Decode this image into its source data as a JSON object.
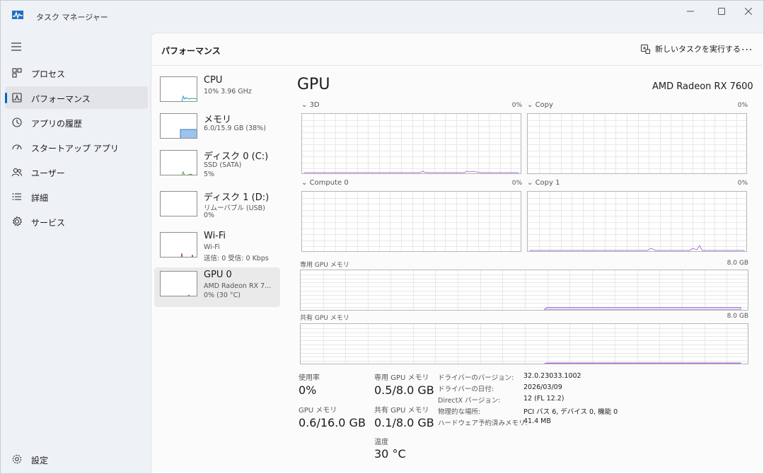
{
  "app": {
    "title": "タスク マネージャー"
  },
  "nav": {
    "items": [
      {
        "label": "プロセス",
        "icon": "processes-icon"
      },
      {
        "label": "パフォーマンス",
        "icon": "performance-icon"
      },
      {
        "label": "アプリの履歴",
        "icon": "history-icon"
      },
      {
        "label": "スタートアップ アプリ",
        "icon": "startup-icon"
      },
      {
        "label": "ユーザー",
        "icon": "users-icon"
      },
      {
        "label": "詳細",
        "icon": "details-icon"
      },
      {
        "label": "サービス",
        "icon": "services-icon"
      }
    ],
    "settings_label": "設定"
  },
  "header": {
    "title": "パフォーマンス",
    "run_task_label": "新しいタスクを実行する",
    "more_label": "..."
  },
  "devices": [
    {
      "name": "CPU",
      "sub1": "10%  3.96 GHz",
      "sub2": ""
    },
    {
      "name": "メモリ",
      "sub1": "6.0/15.9 GB (38%)",
      "sub2": ""
    },
    {
      "name": "ディスク 0 (C:)",
      "sub1": "SSD (SATA)",
      "sub2": "5%"
    },
    {
      "name": "ディスク 1 (D:)",
      "sub1": "リムーバブル (USB)",
      "sub2": "0%"
    },
    {
      "name": "Wi-Fi",
      "sub1": "Wi-Fi",
      "sub2": "送信: 0 受信: 0 Kbps"
    },
    {
      "name": "GPU 0",
      "sub1": "AMD Radeon RX 7...",
      "sub2": "0% (30 °C)"
    }
  ],
  "detail": {
    "title": "GPU",
    "model": "AMD Radeon RX 7600",
    "graphs": {
      "g3d": {
        "label": "3D",
        "pct": "0%"
      },
      "copy": {
        "label": "Copy",
        "pct": "0%"
      },
      "compute0": {
        "label": "Compute 0",
        "pct": "0%"
      },
      "copy1": {
        "label": "Copy 1",
        "pct": "0%"
      },
      "dedicated": {
        "label": "専用 GPU メモリ",
        "max": "8.0 GB",
        "level": 0.0625
      },
      "shared": {
        "label": "共有 GPU メモリ",
        "max": "8.0 GB",
        "level": 0.0125
      }
    },
    "stats": {
      "usage_label": "使用率",
      "usage_value": "0%",
      "dedicated_label": "専用 GPU メモリ",
      "dedicated_value": "0.5/8.0 GB",
      "gpumem_label": "GPU メモリ",
      "gpumem_value": "0.6/16.0 GB",
      "shared_label": "共有 GPU メモリ",
      "shared_value": "0.1/8.0 GB",
      "temp_label": "温度",
      "temp_value": "30 °C"
    },
    "info": [
      {
        "key": "ドライバーのバージョン:",
        "value": "32.0.23033.1002"
      },
      {
        "key": "ドライバーの日付:",
        "value": "2026/03/09"
      },
      {
        "key": "DirectX バージョン:",
        "value": "12 (FL 12.2)"
      },
      {
        "key": "物理的な場所:",
        "value": "PCI バス 6, デバイス 0, 機能 0"
      },
      {
        "key": "ハードウェア予約済みメモリ:",
        "value": "41.4 MB"
      }
    ]
  },
  "colors": {
    "accent": "#0067c0",
    "gpu_line": "#a875d6",
    "cpu_line": "#17a2b8",
    "mem_fill": "#8ab8e6",
    "disk_line": "#4c9a2a",
    "net_line": "#b0476a"
  }
}
